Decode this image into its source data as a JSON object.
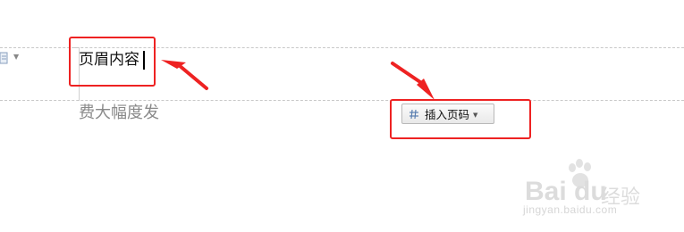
{
  "header": {
    "text": "页眉内容"
  },
  "body": {
    "text": "费大幅度发"
  },
  "toolbar": {
    "insert_page_number_label": "插入页码",
    "insert_page_number_icon": "page-number-icon",
    "dropdown_icon": "chevron-down-icon"
  },
  "left_toolbar": {
    "icon": "document-icon"
  },
  "annotations": {
    "highlight_color": "#ee2222",
    "arrow_color": "#ee2222"
  },
  "watermark": {
    "brand": "Bai du",
    "brand_cn": "经验",
    "url": "jingyan.baidu.com"
  }
}
